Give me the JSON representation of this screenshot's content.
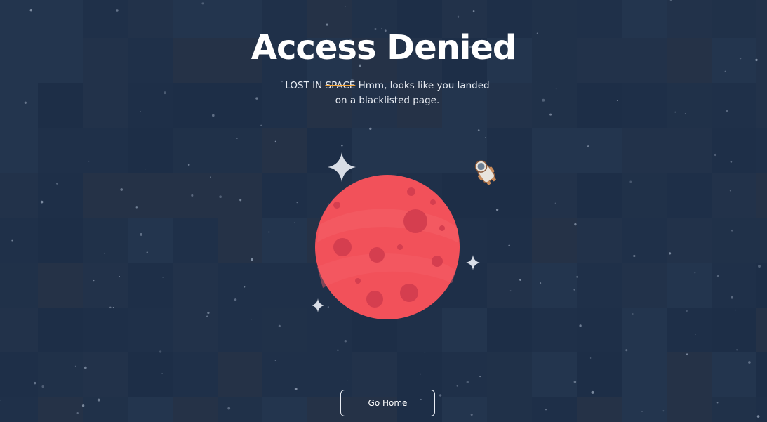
{
  "page": {
    "title": "Access Denied",
    "subtitle_prefix": "LOST IN",
    "subtitle_struck": "SPACE",
    "subtitle_text": "Hmm, looks like you landed on a blacklisted page.",
    "button_label": "Go Home"
  },
  "colors": {
    "background": "#1f3049",
    "planet": "#f2515a",
    "crater": "#d53e4f",
    "strike_accent": "#f5a536",
    "text": "#ffffff"
  },
  "icons": {
    "planet": "red-planet-icon",
    "astronaut": "astronaut-icon",
    "sparkles": "sparkle-icon"
  }
}
